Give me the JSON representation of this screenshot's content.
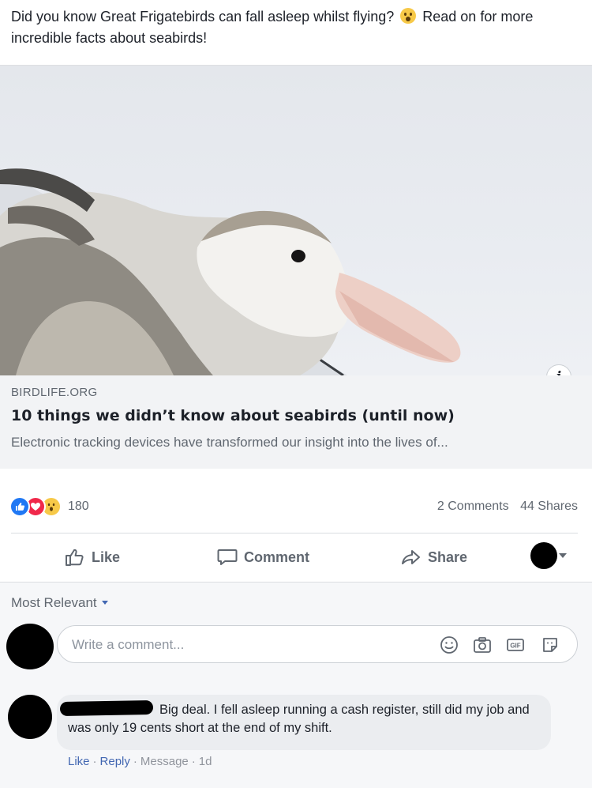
{
  "post": {
    "text_before_emoji": "Did you know Great Frigatebirds can fall asleep whilst flying?",
    "emoji": "wow-emoji",
    "text_after_emoji": "Read on for more incredible facts about seabirds!"
  },
  "link_card": {
    "image": "albatross-photo",
    "domain": "BIRDLIFE.ORG",
    "title": "10 things we didn’t know about seabirds (until now)",
    "description": "Electronic tracking devices have transformed our insight into the lives of...",
    "info_icon": "info-icon"
  },
  "stats": {
    "reaction_icons": [
      "like-reaction-icon",
      "love-reaction-icon",
      "wow-reaction-icon"
    ],
    "reaction_count": "180",
    "comments": "2 Comments",
    "shares": "44 Shares"
  },
  "actions": {
    "like": "Like",
    "comment": "Comment",
    "share": "Share"
  },
  "comments": {
    "sort_label": "Most Relevant",
    "input_placeholder": "Write a comment...",
    "input_icons": [
      "emoji-icon",
      "camera-icon",
      "gif-icon",
      "sticker-icon"
    ],
    "items": [
      {
        "text": "Big deal. I fell asleep running a cash register, still did my job and was only 19 cents short at the end of my shift.",
        "like": "Like",
        "reply": "Reply",
        "message": "Message",
        "time": "1d"
      }
    ]
  },
  "colors": {
    "link_blue": "#4267b2",
    "like_blue": "#2078f4",
    "love_red": "#f0284a",
    "wow_yellow": "#f7c948",
    "meta_gray": "#606770"
  }
}
